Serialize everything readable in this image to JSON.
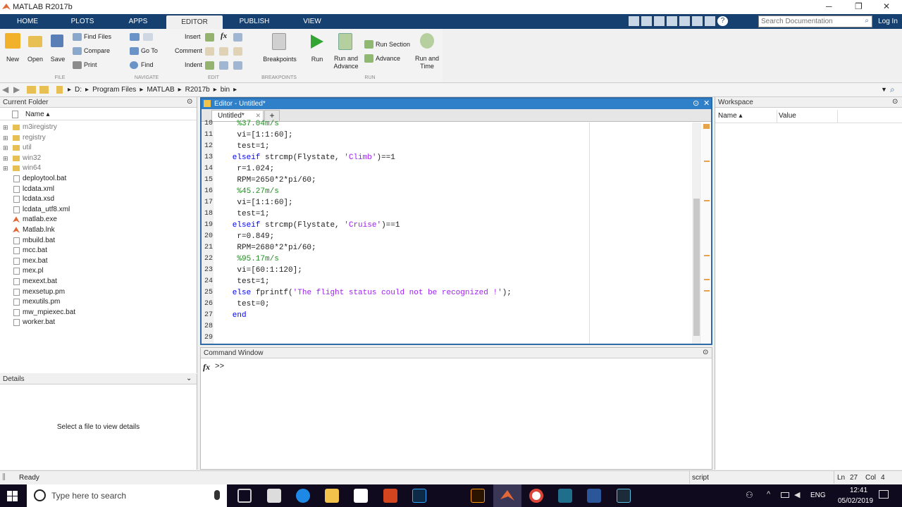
{
  "app": {
    "title": "MATLAB R2017b"
  },
  "tabs": [
    "HOME",
    "PLOTS",
    "APPS",
    "EDITOR",
    "PUBLISH",
    "VIEW"
  ],
  "search": {
    "placeholder": "Search Documentation"
  },
  "login": "Log In",
  "ribbon": {
    "file": {
      "new": "New",
      "open": "Open",
      "save": "Save",
      "find_files": "Find Files",
      "compare": "Compare",
      "print": "Print",
      "label": "FILE"
    },
    "navigate": {
      "go_to": "Go To",
      "find": "Find",
      "label": "NAVIGATE"
    },
    "edit": {
      "insert": "Insert",
      "comment": "Comment",
      "indent": "Indent",
      "label": "EDIT"
    },
    "breakpoints": {
      "button": "Breakpoints",
      "label": "BREAKPOINTS"
    },
    "run": {
      "run": "Run",
      "run_and_advance": "Run and\nAdvance",
      "run_section": "Run Section",
      "advance": "Advance",
      "run_and_time": "Run and\nTime",
      "label": "RUN"
    }
  },
  "path": [
    "D:",
    "Program Files",
    "MATLAB",
    "R2017b",
    "bin"
  ],
  "current_folder": {
    "title": "Current Folder",
    "col_name": "Name ▴",
    "folders": [
      "m3iregistry",
      "registry",
      "util",
      "win32",
      "win64"
    ],
    "files": [
      "deploytool.bat",
      "lcdata.xml",
      "lcdata.xsd",
      "lcdata_utf8.xml",
      "matlab.exe",
      "Matlab.lnk",
      "mbuild.bat",
      "mcc.bat",
      "mex.bat",
      "mex.pl",
      "mexext.bat",
      "mexsetup.pm",
      "mexutils.pm",
      "mw_mpiexec.bat",
      "worker.bat"
    ]
  },
  "details": {
    "title": "Details",
    "message": "Select a file to view details"
  },
  "editor": {
    "title": "Editor - Untitled*",
    "tab": "Untitled*",
    "lines": [
      {
        "n": "10",
        "parts": [
          [
            "cm",
            "    %37.04m/s"
          ]
        ]
      },
      {
        "n": "11",
        "parts": [
          [
            "",
            "    vi=[1:1:60];"
          ]
        ]
      },
      {
        "n": "12",
        "parts": [
          [
            "",
            "    test=1;"
          ]
        ]
      },
      {
        "n": "13",
        "parts": [
          [
            "kw",
            "elseif"
          ],
          [
            "",
            " strcmp(Flystate, "
          ],
          [
            "str",
            "'Climb'"
          ],
          [
            "",
            ")==1"
          ]
        ]
      },
      {
        "n": "14",
        "parts": [
          [
            "",
            "    r=1.024;"
          ]
        ]
      },
      {
        "n": "15",
        "parts": [
          [
            "",
            "    RPM=2650*2*pi/60;"
          ]
        ]
      },
      {
        "n": "16",
        "parts": [
          [
            "cm",
            "    %45.27m/s"
          ]
        ]
      },
      {
        "n": "17",
        "parts": [
          [
            "",
            "    vi=[1:1:60];"
          ]
        ]
      },
      {
        "n": "18",
        "parts": [
          [
            "",
            "    test=1;"
          ]
        ]
      },
      {
        "n": "19",
        "parts": [
          [
            "kw",
            "elseif"
          ],
          [
            "",
            " strcmp(Flystate, "
          ],
          [
            "str",
            "'Cruise'"
          ],
          [
            "",
            ")==1"
          ]
        ]
      },
      {
        "n": "20",
        "parts": [
          [
            "",
            "    r=0.849;"
          ]
        ]
      },
      {
        "n": "21",
        "parts": [
          [
            "",
            "    RPM=2680*2*pi/60;"
          ]
        ]
      },
      {
        "n": "22",
        "parts": [
          [
            "cm",
            "    %95.17m/s"
          ]
        ]
      },
      {
        "n": "23",
        "parts": [
          [
            "",
            "    vi=[60:1:120];"
          ]
        ]
      },
      {
        "n": "24",
        "parts": [
          [
            "",
            "    test=1;"
          ]
        ]
      },
      {
        "n": "25",
        "parts": [
          [
            "kw",
            "else"
          ],
          [
            "",
            " fprintf("
          ],
          [
            "str",
            "'The flight status could not be recognized !'"
          ],
          [
            "",
            ");"
          ]
        ]
      },
      {
        "n": "26",
        "parts": [
          [
            "",
            "    test=0;"
          ]
        ]
      },
      {
        "n": "27",
        "parts": [
          [
            "kw",
            "end"
          ]
        ]
      },
      {
        "n": "28",
        "parts": [
          [
            "",
            ""
          ]
        ]
      },
      {
        "n": "29",
        "parts": [
          [
            "",
            ""
          ]
        ]
      }
    ]
  },
  "command_window": {
    "title": "Command Window",
    "prompt": ">>",
    "fx": "fx"
  },
  "workspace": {
    "title": "Workspace",
    "col_name": "Name ▴",
    "col_value": "Value"
  },
  "status": {
    "left": "Ready",
    "mode": "script",
    "ln_label": "Ln",
    "ln": "27",
    "col_label": "Col",
    "col": "4"
  },
  "taskbar": {
    "search": "Type here to search",
    "lang": "ENG",
    "time": "12:41",
    "date": "05/02/2019"
  },
  "colors": {
    "tab_bar": "#16406f",
    "editor_header": "#2f7fc9",
    "taskbar": "#0f0a1e"
  }
}
